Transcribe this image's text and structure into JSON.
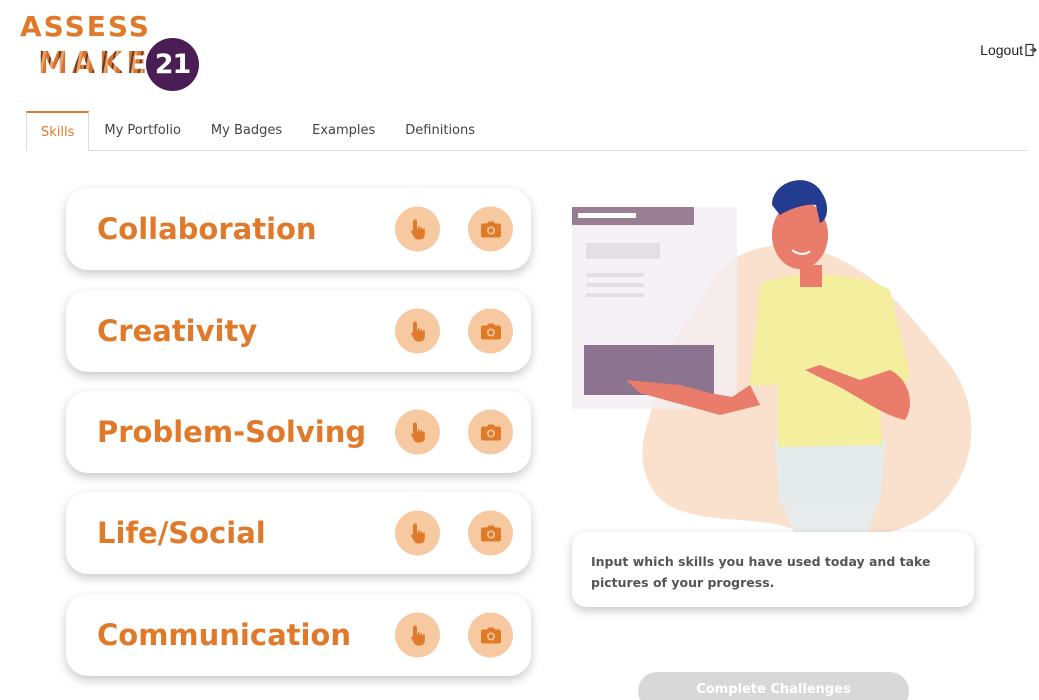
{
  "logo": {
    "line1": "ASSESS",
    "line2": "MAKE",
    "badge": "21"
  },
  "header": {
    "logout_label": "Logout",
    "logout_icon": "logout-icon"
  },
  "tabs": [
    {
      "label": "Skills",
      "active": true
    },
    {
      "label": "My Portfolio",
      "active": false
    },
    {
      "label": "My Badges",
      "active": false
    },
    {
      "label": "Examples",
      "active": false
    },
    {
      "label": "Definitions",
      "active": false
    }
  ],
  "skills": [
    {
      "label": "Collaboration",
      "input_icon": "hand-pointer-icon",
      "photo_icon": "camera-icon"
    },
    {
      "label": "Creativity",
      "input_icon": "hand-pointer-icon",
      "photo_icon": "camera-icon"
    },
    {
      "label": "Problem-Solving",
      "input_icon": "hand-pointer-icon",
      "photo_icon": "camera-icon"
    },
    {
      "label": "Life/Social",
      "input_icon": "hand-pointer-icon",
      "photo_icon": "camera-icon"
    },
    {
      "label": "Communication",
      "input_icon": "hand-pointer-icon",
      "photo_icon": "camera-icon"
    }
  ],
  "info": {
    "text": "Input which skills you have used today and take pictures of your progress."
  },
  "complete_button": {
    "label": "Complete Challenges"
  },
  "colors": {
    "accent": "#e07a2a",
    "button_circle": "#f6c9a0",
    "badge": "#4a1d55",
    "disabled_button": "#d8d8d8"
  }
}
